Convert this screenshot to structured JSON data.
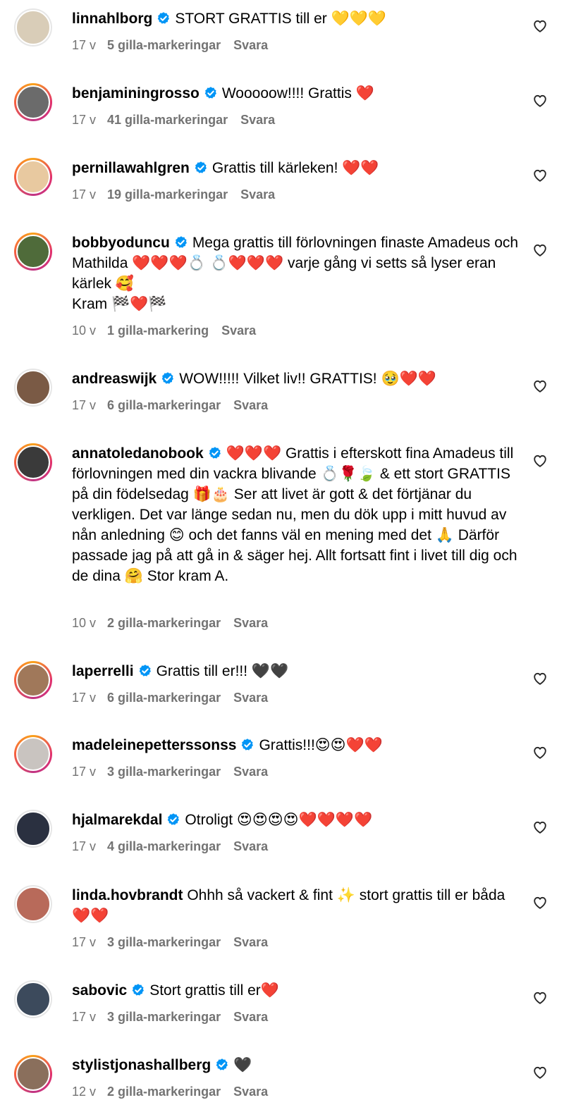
{
  "comments": [
    {
      "username": "linnahlborg",
      "verified": true,
      "text": "STORT GRATTIS till er 💛💛💛",
      "time": "17 v",
      "likes": "5 gilla-markeringar",
      "reply": "Svara",
      "ring": false,
      "avatar_color": "#d9cdb8"
    },
    {
      "username": "benjaminingrosso",
      "verified": true,
      "text": "Wooooow!!!! Grattis ❤️",
      "time": "17 v",
      "likes": "41 gilla-markeringar",
      "reply": "Svara",
      "ring": true,
      "avatar_color": "#6b6b6b"
    },
    {
      "username": "pernillawahlgren",
      "verified": true,
      "text": "Grattis till kärleken! ❤️❤️",
      "time": "17 v",
      "likes": "19 gilla-markeringar",
      "reply": "Svara",
      "ring": true,
      "avatar_color": "#e8c9a0"
    },
    {
      "username": "bobbyoduncu",
      "verified": true,
      "text": "Mega grattis till förlovningen finaste Amadeus och Mathilda ❤️❤️❤️💍 💍❤️❤️❤️ varje gång vi setts så lyser eran kärlek 🥰\nKram 🏁❤️🏁",
      "time": "10 v",
      "likes": "1 gilla-markering",
      "reply": "Svara",
      "ring": true,
      "avatar_color": "#4f6b3a"
    },
    {
      "username": "andreaswijk",
      "verified": true,
      "text": "WOW!!!!! Vilket liv!! GRATTIS! 🥹❤️❤️",
      "time": "17 v",
      "likes": "6 gilla-markeringar",
      "reply": "Svara",
      "ring": false,
      "avatar_color": "#7a5a45"
    },
    {
      "username": "annatoledanobook",
      "verified": true,
      "text": "❤️❤️❤️ Grattis i efterskott fina Amadeus till förlovningen med din vackra blivande 💍🌹🍃 & ett stort GRATTIS på din födelsedag 🎁🎂 Ser att livet är gott & det förtjänar du verkligen. Det var länge sedan nu, men du dök upp i mitt huvud av nån anledning 😊 och det fanns väl en mening med det 🙏 Därför passade jag på att gå in & säger hej. Allt fortsatt fint i livet till dig och de dina 🤗 Stor kram A.",
      "time": "10 v",
      "likes": "2 gilla-markeringar",
      "reply": "Svara",
      "ring": true,
      "avatar_color": "#3a3a3a"
    },
    {
      "username": "laperrelli",
      "verified": true,
      "text": "Grattis till er!!! 🖤🖤",
      "time": "17 v",
      "likes": "6 gilla-markeringar",
      "reply": "Svara",
      "ring": true,
      "avatar_color": "#a0785a"
    },
    {
      "username": "madeleinepetterssonss",
      "verified": true,
      "text": "Grattis!!!😍😍❤️❤️",
      "time": "17 v",
      "likes": "3 gilla-markeringar",
      "reply": "Svara",
      "ring": true,
      "avatar_color": "#c9c4c0"
    },
    {
      "username": "hjalmarekdal",
      "verified": true,
      "text": "Otroligt 😍😍😍😍❤️❤️❤️❤️",
      "time": "17 v",
      "likes": "4 gilla-markeringar",
      "reply": "Svara",
      "ring": false,
      "avatar_color": "#2a3040"
    },
    {
      "username": "linda.hovbrandt",
      "verified": false,
      "text": "Ohhh så vackert & fint ✨ stort grattis till er båda ❤️❤️",
      "time": "17 v",
      "likes": "3 gilla-markeringar",
      "reply": "Svara",
      "ring": false,
      "avatar_color": "#b86a5a"
    },
    {
      "username": "sabovic",
      "verified": true,
      "text": "Stort grattis till er❤️",
      "time": "17 v",
      "likes": "3 gilla-markeringar",
      "reply": "Svara",
      "ring": false,
      "avatar_color": "#3c4a5c"
    },
    {
      "username": "stylistjonashallberg",
      "verified": true,
      "text": "🖤",
      "time": "12 v",
      "likes": "2 gilla-markeringar",
      "reply": "Svara",
      "ring": true,
      "avatar_color": "#8a6f5c"
    }
  ],
  "colors": {
    "verified": "#0095f6",
    "meta": "#737373",
    "text": "#000000"
  },
  "icons": {
    "verified": "verified-badge-icon",
    "like": "heart-outline-icon"
  }
}
